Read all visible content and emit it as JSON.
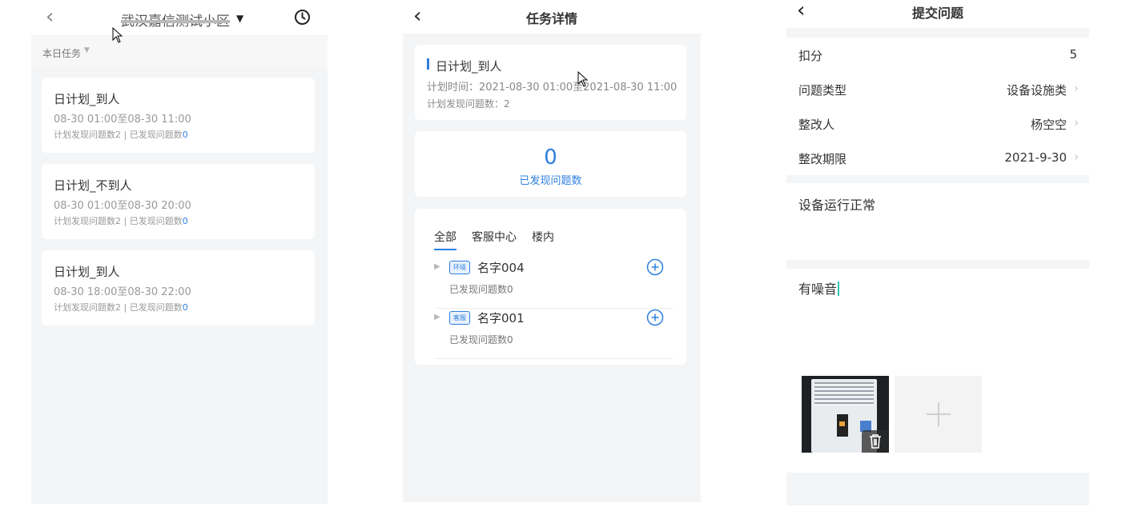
{
  "screen1": {
    "title": "武汉嘉信测试小区",
    "subtitle": "本日任务",
    "icons": {
      "back": "chevron-left-icon",
      "dropdown": "caret-down-icon",
      "history": "clock-icon"
    },
    "tasks": [
      {
        "title": "日计划_到人",
        "time": "08-30 01:00至08-30 11:00",
        "stats_prefix": "计划发现问题数2 | 已发现问题数",
        "found": "0"
      },
      {
        "title": "日计划_不到人",
        "time": "08-30 01:00至08-30 20:00",
        "stats_prefix": "计划发现问题数2 | 已发现问题数",
        "found": "0"
      },
      {
        "title": "日计划_到人",
        "time": "08-30 18:00至08-30 22:00",
        "stats_prefix": "计划发现问题数2 | 已发现问题数",
        "found": "0"
      }
    ]
  },
  "screen2": {
    "title": "任务详情",
    "task_title": "日计划_到人",
    "plan_time": "计划时间：2021-08-30 01:00至2021-08-30 11:00",
    "plan_count": "计划发现问题数：2",
    "found_count": "0",
    "found_label": "已发现问题数",
    "tabs": [
      "全部",
      "客服中心",
      "楼内"
    ],
    "items": [
      {
        "tag": "环境",
        "name": "名字004",
        "found": "已发现问题数0"
      },
      {
        "tag": "客服",
        "name": "名字001",
        "found": "已发现问题数0"
      }
    ]
  },
  "screen3": {
    "title": "提交问题",
    "fields": [
      {
        "label": "扣分",
        "value": "5"
      },
      {
        "label": "问题类型",
        "value": "设备设施类"
      },
      {
        "label": "整改人",
        "value": "杨空空"
      },
      {
        "label": "整改期限",
        "value": "2021-9-30"
      }
    ],
    "description": "设备运行正常",
    "problem_text": "有噪音"
  },
  "colors": {
    "accent": "#2e7fe0",
    "background": "#f4f5f6",
    "cursor": "#2fc4b2"
  }
}
